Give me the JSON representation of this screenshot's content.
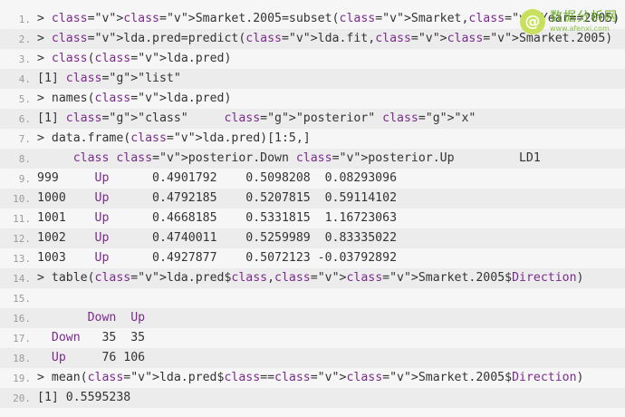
{
  "lines": [
    {
      "n": "1.",
      "shade": false,
      "text": "> Smarket.2005=subset(Smarket,Year==2005)"
    },
    {
      "n": "2.",
      "shade": true,
      "text": "> lda.pred=predict(lda.fit,Smarket.2005)"
    },
    {
      "n": "3.",
      "shade": false,
      "text": "> class(lda.pred)"
    },
    {
      "n": "4.",
      "shade": true,
      "text": "[1] \"list\""
    },
    {
      "n": "5.",
      "shade": false,
      "text": "> names(lda.pred)"
    },
    {
      "n": "6.",
      "shade": true,
      "text": "[1] \"class\"     \"posterior\" \"x\""
    },
    {
      "n": "7.",
      "shade": false,
      "text": "> data.frame(lda.pred)[1:5,]"
    },
    {
      "n": "8.",
      "shade": true,
      "text": "     class posterior.Down posterior.Up         LD1"
    },
    {
      "n": "9.",
      "shade": false,
      "text": "999     Up      0.4901792    0.5098208  0.08293096"
    },
    {
      "n": "10.",
      "shade": true,
      "text": "1000    Up      0.4792185    0.5207815  0.59114102"
    },
    {
      "n": "11.",
      "shade": false,
      "text": "1001    Up      0.4668185    0.5331815  1.16723063"
    },
    {
      "n": "12.",
      "shade": true,
      "text": "1002    Up      0.4740011    0.5259989  0.83335022"
    },
    {
      "n": "13.",
      "shade": false,
      "text": "1003    Up      0.4927877    0.5072123 -0.03792892"
    },
    {
      "n": "14.",
      "shade": true,
      "text": "> table(lda.pred$class,Smarket.2005$Direction)"
    },
    {
      "n": "15.",
      "shade": false,
      "text": ""
    },
    {
      "n": "16.",
      "shade": true,
      "text": "       Down  Up"
    },
    {
      "n": "17.",
      "shade": false,
      "text": "  Down   35  35"
    },
    {
      "n": "18.",
      "shade": true,
      "text": "  Up     76 106"
    },
    {
      "n": "19.",
      "shade": false,
      "text": "> mean(lda.pred$class==Smarket.2005$Direction)"
    },
    {
      "n": "20.",
      "shade": true,
      "text": "[1] 0.5595238"
    }
  ],
  "watermark": {
    "glyph": "@",
    "cn": "数据分析网",
    "url": "www.afenxi.com"
  },
  "colors": {
    "background": "#f6f6f6",
    "shaded_row": "#ececec",
    "identifier": "#7a2c8c",
    "string": "#2e8a2e",
    "line_number": "#9a9a9a"
  }
}
